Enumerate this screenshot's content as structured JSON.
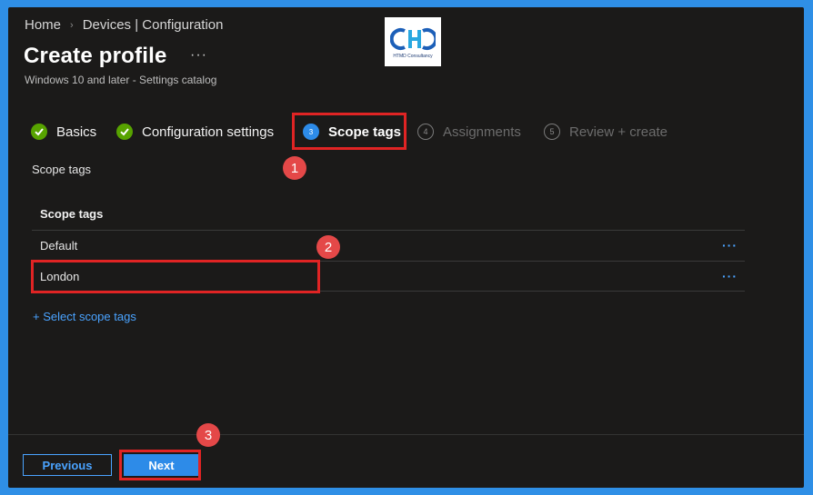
{
  "breadcrumb": [
    "Home",
    "Devices | Configuration"
  ],
  "page": {
    "title": "Create profile",
    "more": "···",
    "subtitle": "Windows 10 and later - Settings catalog"
  },
  "logo": {
    "caption": "HTMD Consultancy"
  },
  "steps": [
    {
      "label": "Basics",
      "status": "done",
      "num": ""
    },
    {
      "label": "Configuration settings",
      "status": "done",
      "num": ""
    },
    {
      "label": "Scope tags",
      "status": "current",
      "num": "3"
    },
    {
      "label": "Assignments",
      "status": "todo",
      "num": "4"
    },
    {
      "label": "Review + create",
      "status": "todo",
      "num": "5"
    }
  ],
  "section_label": "Scope tags",
  "table": {
    "header": "Scope tags",
    "rows": [
      {
        "name": "Default",
        "more": "···"
      },
      {
        "name": "London",
        "more": "···"
      }
    ]
  },
  "select_link": "+ Select scope tags",
  "buttons": {
    "previous": "Previous",
    "next": "Next"
  },
  "callouts": [
    "1",
    "2",
    "3"
  ],
  "colors": {
    "accent": "#2d8be8",
    "success": "#57a300",
    "highlight": "#e02424",
    "callout": "#e44848",
    "background": "#1b1a19"
  }
}
